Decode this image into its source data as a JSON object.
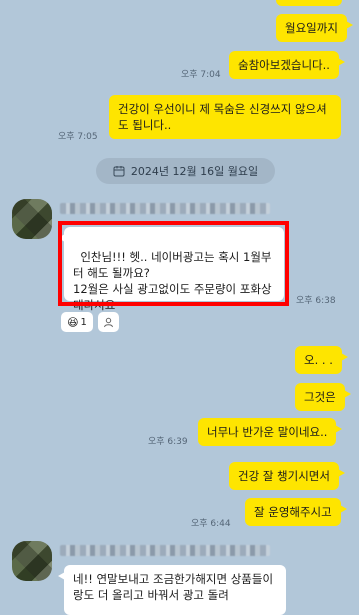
{
  "messages": [
    {
      "side": "me",
      "text": "월요일까지",
      "time": ""
    },
    {
      "side": "me",
      "text": "숨참아보겠습니다..",
      "time": "오후 7:04"
    },
    {
      "side": "me",
      "text": "건강이 우선이니 제 목숨은 신경쓰지 않으셔도 됩니다..",
      "time": "오후 7:05"
    },
    {
      "side": "other",
      "text": "인찬님!!! 헷.. 네이버광고는 혹시 1월부터 해도 될까요?\n12월은 사실 광고없이도 주문량이 포화상태라서요",
      "time": "오후 6:38"
    },
    {
      "side": "me",
      "text": "오. . .",
      "time": ""
    },
    {
      "side": "me",
      "text": "그것은",
      "time": ""
    },
    {
      "side": "me",
      "text": "너무나 반가운 말이네요..",
      "time": "오후 6:39"
    },
    {
      "side": "me",
      "text": "건강 잘 챙기시면서",
      "time": ""
    },
    {
      "side": "me",
      "text": "잘 운영해주시고",
      "time": "오후 6:44"
    },
    {
      "side": "other",
      "text": "네!! 연말보내고 조금한가해지면 상품들이랑도 더 올리고 바꿔서 광고 돌려",
      "time": ""
    }
  ],
  "date_divider": "2024년 12월 16일 월요일",
  "reactions": {
    "emoji_count": "1"
  },
  "icons": {
    "calendar": "calendar-icon",
    "emoji": "laughing-emoji-icon",
    "person": "person-icon"
  }
}
